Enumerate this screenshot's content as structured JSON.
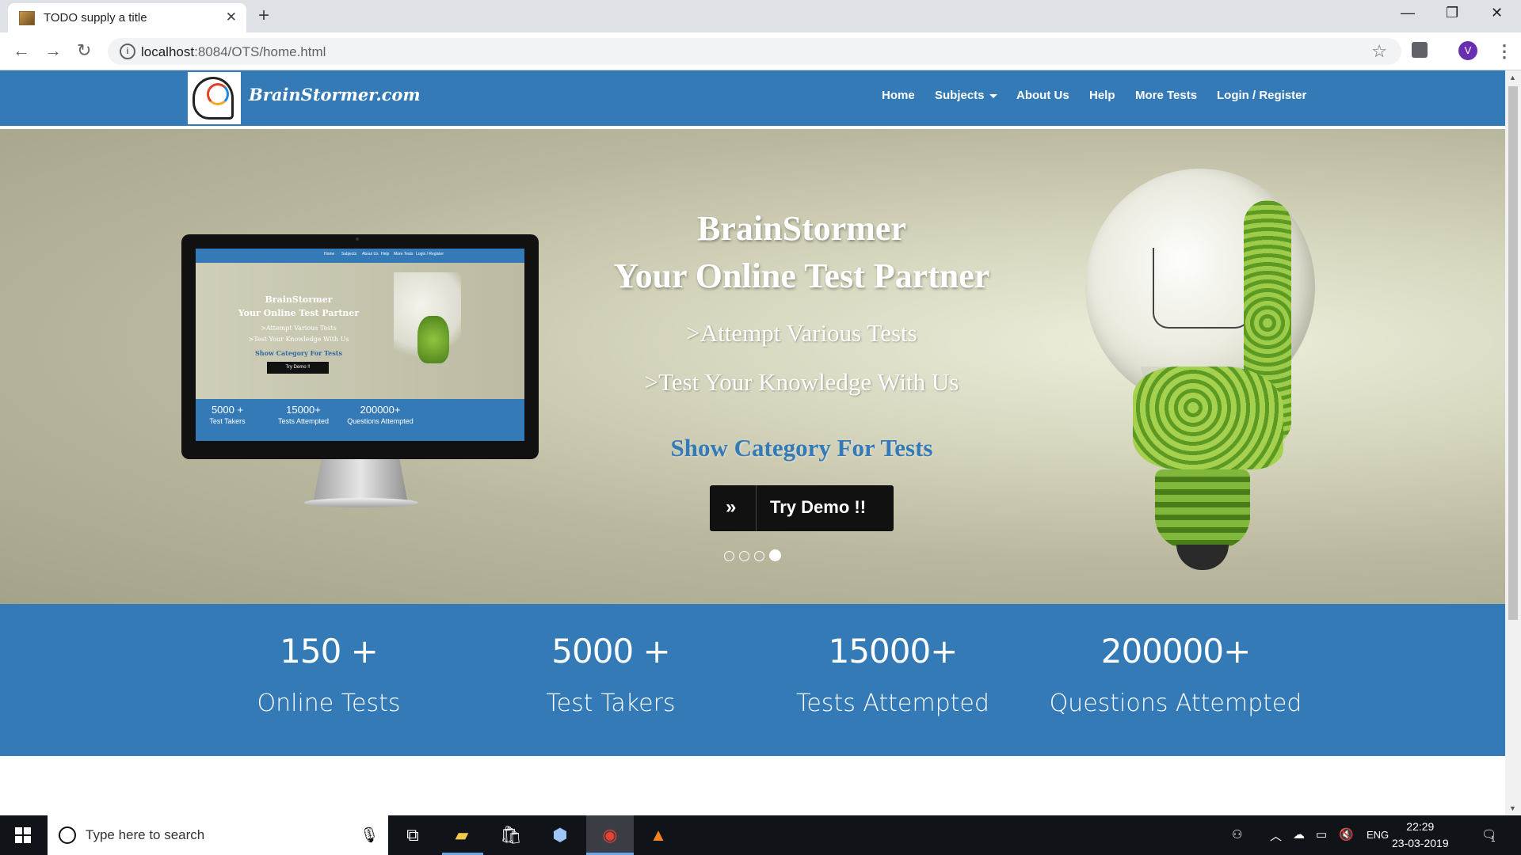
{
  "browser": {
    "tab_title": "TODO supply a title",
    "tab_close": "✕",
    "new_tab": "+",
    "window_controls": {
      "minimize": "—",
      "restore": "❐",
      "close": "✕"
    },
    "url_host": "localhost",
    "url_path": ":8084/OTS/home.html",
    "profile_initial": "V"
  },
  "site": {
    "brand": "BrainStormer.com",
    "nav": {
      "home": "Home",
      "subjects": "Subjects",
      "about": "About Us",
      "help": "Help",
      "more_tests": "More Tests",
      "login": "Login / Register"
    }
  },
  "hero": {
    "title_line1": "BrainStormer",
    "title_line2": "Your Online Test Partner",
    "bullet1": ">Attempt Various Tests",
    "bullet2": ">Test Your Knowledge With Us",
    "category_link": "Show Category For Tests",
    "demo_button": "Try Demo !!",
    "carousel": {
      "slides": 4,
      "active_index": 3
    },
    "preview": {
      "nav_items": [
        "Home",
        "Subjects",
        "About Us",
        "Help",
        "More Tests",
        "Login / Register"
      ],
      "title_line1": "BrainStormer",
      "title_line2": "Your Online Test Partner",
      "bullet1": ">Attempt Various Tests",
      "bullet2": ">Test Your Knowledge With Us",
      "category_link": "Show Category For Tests",
      "demo_button": "Try Demo !!",
      "stats": [
        {
          "value": "5000 +",
          "label": "Test Takers"
        },
        {
          "value": "15000+",
          "label": "Tests Attempted"
        },
        {
          "value": "200000+",
          "label": "Questions Attempted"
        }
      ]
    }
  },
  "stats": [
    {
      "value": "150 +",
      "label": "Online Tests"
    },
    {
      "value": "5000 +",
      "label": "Test Takers"
    },
    {
      "value": "15000+",
      "label": "Tests Attempted"
    },
    {
      "value": "200000+",
      "label": "Questions Attempted"
    }
  ],
  "taskbar": {
    "search_placeholder": "Type here to search",
    "language": "ENG",
    "time": "22:29",
    "date": "23-03-2019",
    "notification_count": "1"
  },
  "colors": {
    "brand_blue": "#337ab7",
    "taskbar": "#101318"
  },
  "icons": {
    "tab_favicon": "image-icon",
    "back": "arrow-left-icon",
    "forward": "arrow-right-icon",
    "reload": "reload-icon",
    "site_info": "info-icon",
    "bookmark": "star-icon",
    "extension": "extension-icon",
    "menu": "more-vert-icon",
    "start": "windows-icon",
    "microphone": "microphone-icon",
    "task_view": "task-view-icon",
    "file_explorer": "folder-icon",
    "store": "store-icon",
    "box_app": "cube-icon",
    "chrome": "chrome-icon",
    "vlc": "vlc-cone-icon"
  }
}
